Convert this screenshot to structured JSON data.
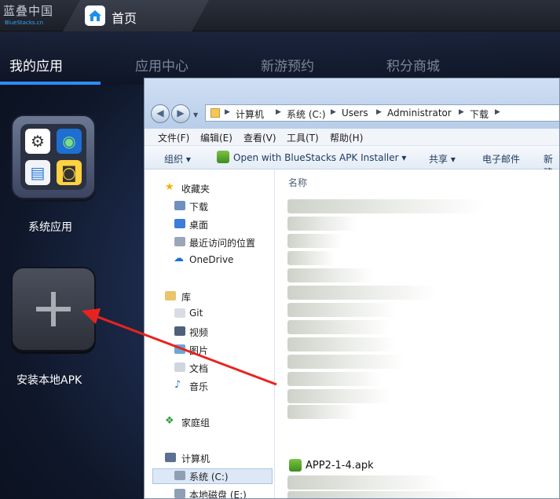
{
  "bluestacks": {
    "brand_cn": "蓝叠中国",
    "brand_en": "BlueStacks.cn",
    "home_tab": "首页",
    "nav": [
      "我的应用",
      "应用中心",
      "新游预约",
      "积分商城"
    ],
    "sys_apps_label": "系统应用",
    "install_apk_label": "安装本地APK",
    "accent": "#2e8dff"
  },
  "explorer": {
    "breadcrumbs": [
      "计算机",
      "系统 (C:)",
      "Users",
      "Administrator",
      "下载"
    ],
    "menus": [
      "文件(F)",
      "编辑(E)",
      "查看(V)",
      "工具(T)",
      "帮助(H)"
    ],
    "toolbar": {
      "organize": "组织 ▾",
      "open_with": "Open with BlueStacks APK Installer ▾",
      "share": "共享 ▾",
      "email": "电子邮件",
      "new_folder": "新建"
    },
    "nav_items": {
      "favorites": "收藏夹",
      "downloads": "下载",
      "desktop": "桌面",
      "recent": "最近访问的位置",
      "onedrive": "OneDrive",
      "libraries": "库",
      "git": "Git",
      "videos": "视频",
      "pictures": "图片",
      "documents": "文档",
      "music": "音乐",
      "homegroup": "家庭组",
      "computer": "计算机",
      "drive_c": "系统 (C:)",
      "drive_e": "本地磁盘 (E:)"
    },
    "column_name": "名称",
    "visible_file": "APP2-1-4.apk"
  }
}
